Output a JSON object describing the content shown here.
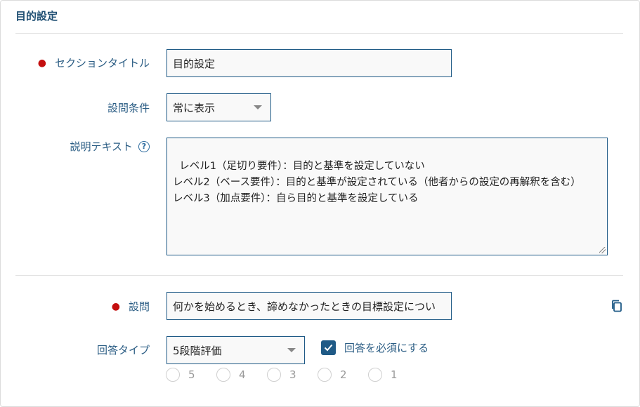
{
  "section": {
    "title": "目的設定"
  },
  "fields": {
    "section_title": {
      "label": "セクションタイトル",
      "value": "目的設定"
    },
    "condition": {
      "label": "設問条件",
      "value": "常に表示"
    },
    "description": {
      "label": "説明テキスト",
      "help_icon": "question-circle-icon",
      "value": "レベル1（足切り要件）：目的と基準を設定していない\nレベル2（ベース要件）：目的と基準が設定されている（他者からの設定の再解釈を含む）\nレベル3（加点要件）：自ら目的と基準を設定している"
    },
    "question": {
      "label": "設問",
      "value": "何かを始めるとき、諦めなかったときの目標設定につい",
      "copy_icon": "copy-icon"
    },
    "answer_type": {
      "label": "回答タイプ",
      "value": "5段階評価"
    },
    "required_checkbox": {
      "label": "回答を必須にする",
      "checked": true
    }
  },
  "ratings": [
    "5",
    "4",
    "3",
    "2",
    "1"
  ],
  "colors": {
    "accent": "#1f5a86",
    "label": "#2b5d84",
    "required": "#c40f0f"
  }
}
